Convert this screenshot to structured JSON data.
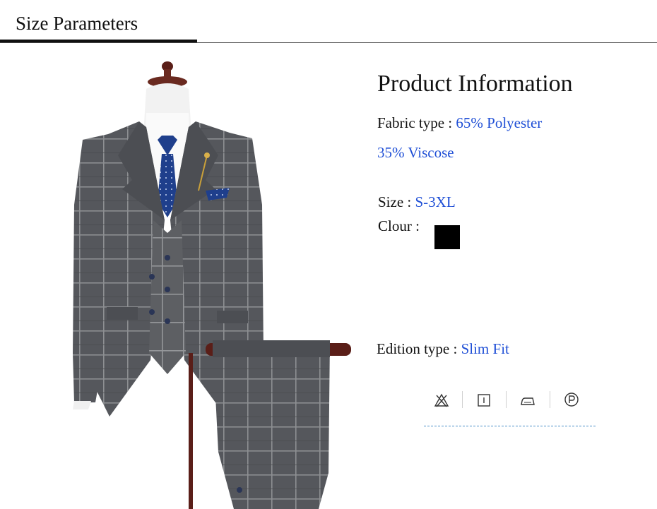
{
  "header": {
    "title": "Size Parameters"
  },
  "info": {
    "title": "Product Information",
    "fabric_label": "Fabric type : ",
    "fabric_value_1": "65% Polyester",
    "fabric_value_2": "35% Viscose",
    "size_label": "Size : ",
    "size_value": "S-3XL",
    "colour_label": "Clour : ",
    "colour_swatch": "#000000",
    "edition_label": "Edition type : ",
    "edition_value": "Slim Fit"
  },
  "care_icons": [
    "no-bleach-icon",
    "tumble-dry-icon",
    "iron-icon",
    "dry-clean-p-icon"
  ],
  "colors": {
    "value_text": "#1f4fd6",
    "suit_fabric": "#55575c",
    "tie": "#1f3f8c",
    "stand_wood": "#5a1e18"
  }
}
